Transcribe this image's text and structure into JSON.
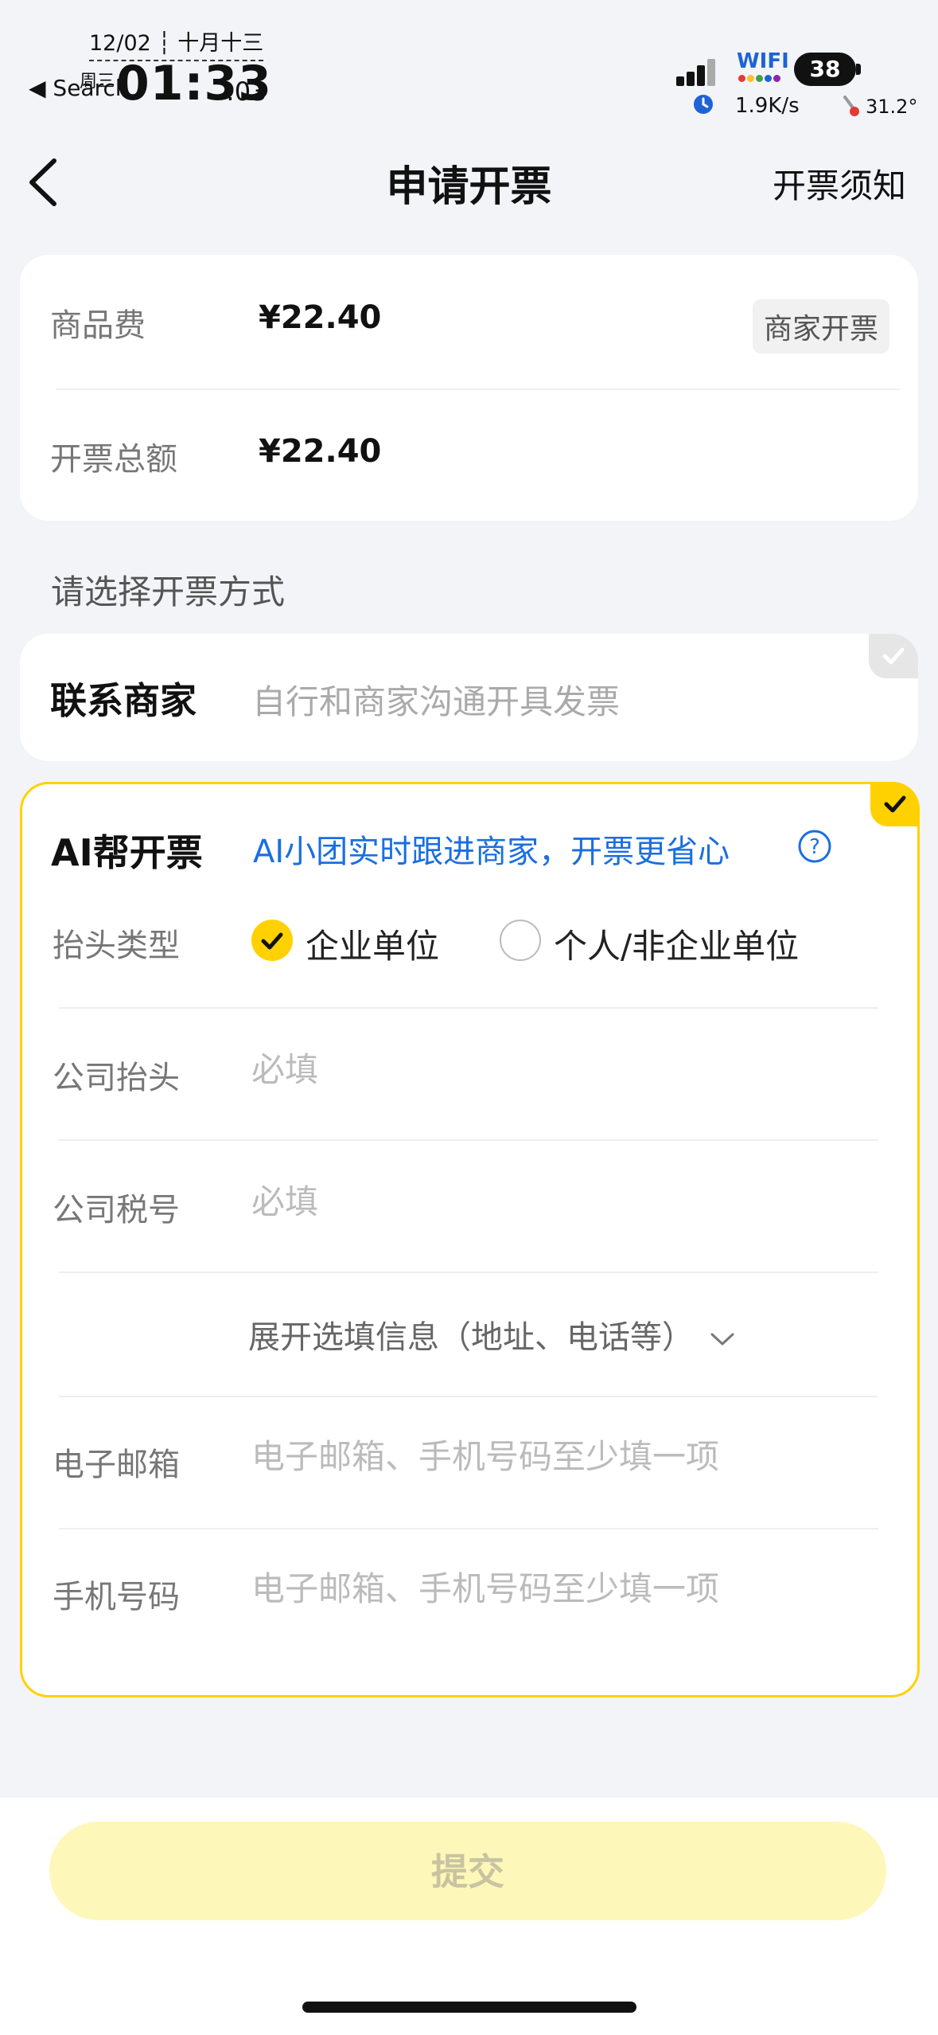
{
  "status_bar": {
    "date": "12/02 ┆ 十月十三",
    "back_app": "◀ Search",
    "weekday": "周三",
    "time": "01:33",
    "seconds": ":03",
    "wifi": "WIFI",
    "battery": "38",
    "speed": "1.9K/s",
    "temp": "31.2°"
  },
  "nav": {
    "title": "申请开票",
    "right_link": "开票须知"
  },
  "summary": {
    "goods_label": "商品费",
    "goods_value": "¥22.40",
    "badge": "商家开票",
    "total_label": "开票总额",
    "total_value": "¥22.40"
  },
  "section_title": "请选择开票方式",
  "option_contact": {
    "title": "联系商家",
    "desc": "自行和商家沟通开具发票"
  },
  "option_ai": {
    "title": "AI帮开票",
    "desc": "AI小团实时跟进商家，开票更省心",
    "header_type_label": "抬头类型",
    "radio_company": "企业单位",
    "radio_personal": "个人/非企业单位",
    "company_title_label": "公司抬头",
    "company_title_placeholder": "必填",
    "tax_id_label": "公司税号",
    "tax_id_placeholder": "必填",
    "expand_text": "展开选填信息（地址、电话等）",
    "email_label": "电子邮箱",
    "email_placeholder": "电子邮箱、手机号码至少填一项",
    "phone_label": "手机号码",
    "phone_placeholder": "电子邮箱、手机号码至少填一项"
  },
  "submit_label": "提交",
  "colors": {
    "accent": "#ffd100",
    "link_blue": "#1a6fe0",
    "submit_disabled": "#fef7ba"
  }
}
